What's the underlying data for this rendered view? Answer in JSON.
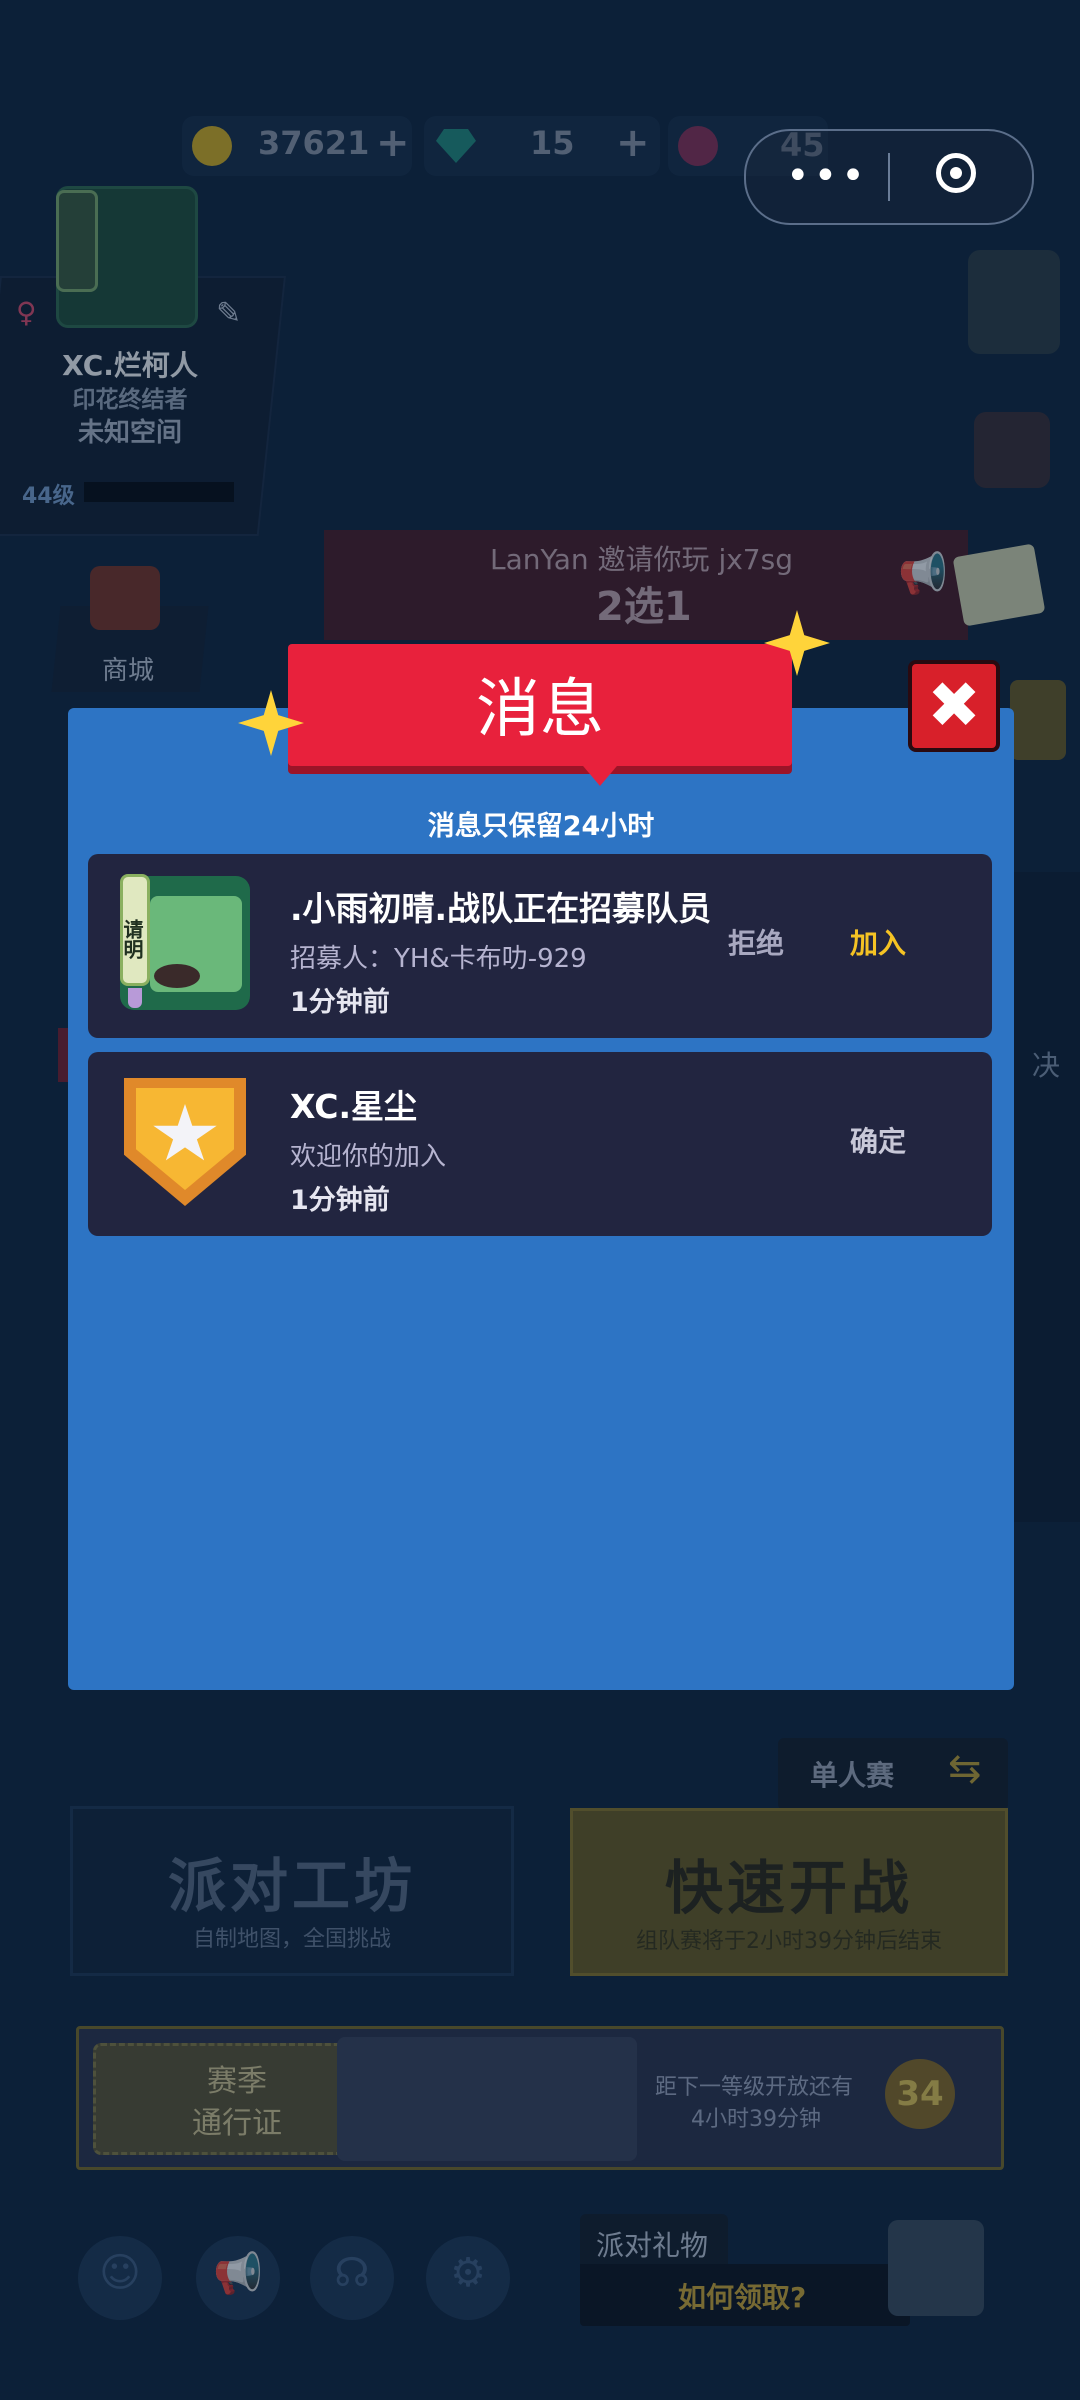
{
  "currency": {
    "coins": "37621",
    "gems": "15",
    "tickets": "45",
    "plus": "+"
  },
  "capsule": {
    "more": "•••"
  },
  "profile": {
    "name": "XC.烂柯人",
    "title": "印花终结者",
    "space": "未知空间",
    "level": "44级",
    "badge_char": "请\n明"
  },
  "invite": {
    "line1": "LanYan 邀请你玩 jx7sg",
    "line2": "2选1"
  },
  "shop": {
    "label": "商城"
  },
  "right_hint": "决",
  "modal": {
    "title": "消息",
    "subtitle": "消息只保留24小时",
    "close": "✖",
    "messages": [
      {
        "title": ".小雨初晴.战队正在招募队员",
        "sub": "招募人：YH&卡布叻-929",
        "time": "1分钟前",
        "reject": "拒绝",
        "join": "加入",
        "icon_text": "请明"
      },
      {
        "title": "XC.星尘",
        "sub": "欢迎你的加入",
        "time": "1分钟前",
        "confirm": "确定"
      }
    ]
  },
  "solo": {
    "label": "单人赛"
  },
  "party_workshop": {
    "title": "派对工坊",
    "sub": "自制地图，全国挑战"
  },
  "quick_start": {
    "title": "快速开战",
    "sub": "组队赛将于2小时39分钟后结束"
  },
  "season": {
    "label1": "赛季",
    "label2": "通行证",
    "info1": "距下一等级开放还有",
    "info2": "4小时39分钟",
    "level": "34"
  },
  "gift": {
    "label": "派对礼物",
    "question": "如何领取?"
  },
  "colors": {
    "modal": "#2d74c4",
    "banner": "#e8213c",
    "join": "#f5c324",
    "star": "#ffd43a"
  }
}
